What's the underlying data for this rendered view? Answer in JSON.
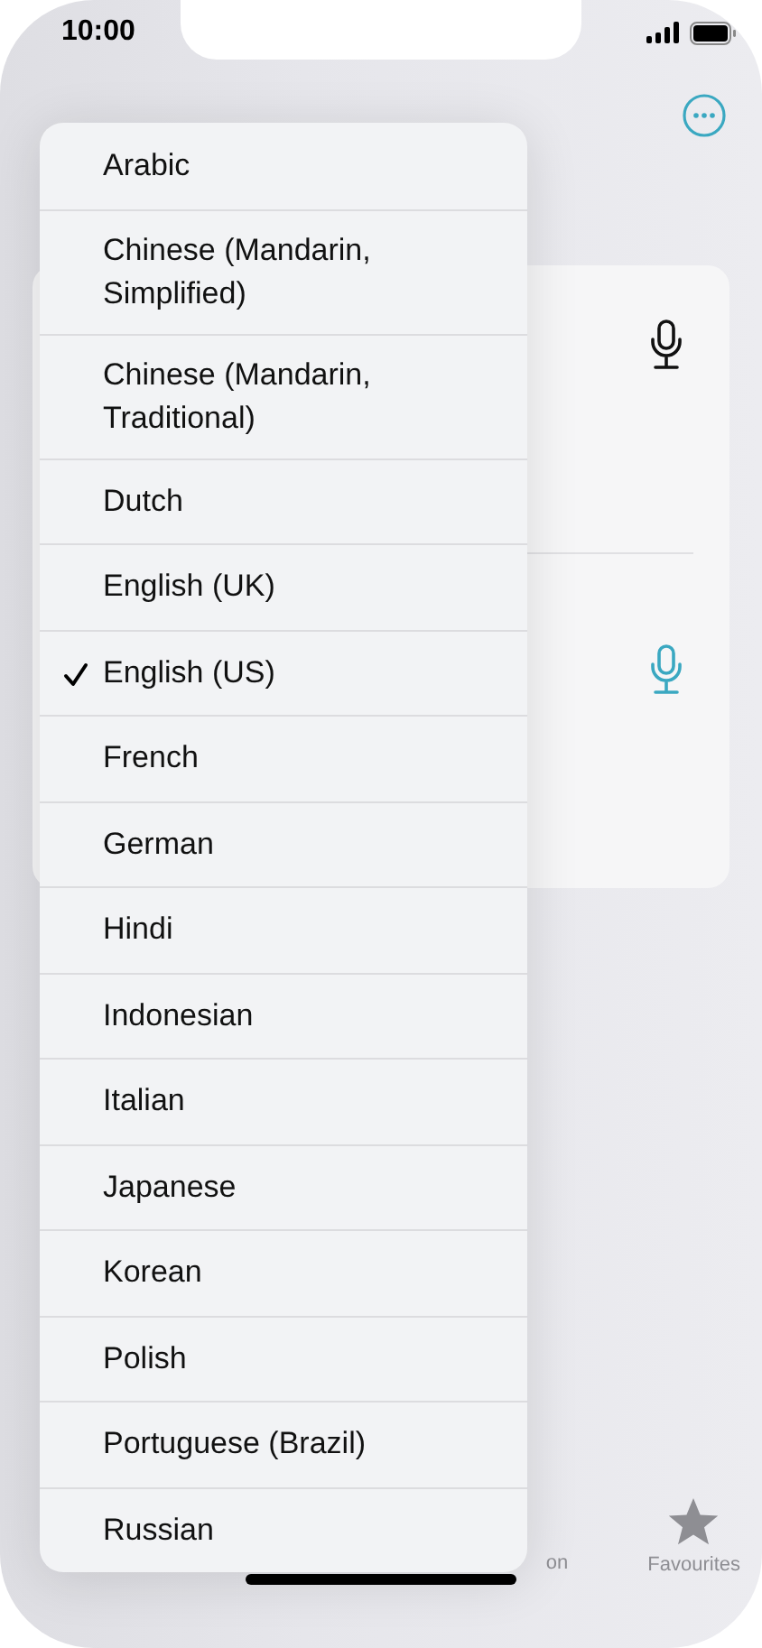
{
  "status_bar": {
    "time": "10:00"
  },
  "card": {
    "rows": [
      {
        "kind": "mic",
        "active": false
      },
      {
        "kind": "mic",
        "active": true
      }
    ]
  },
  "tab_bar": {
    "partial_label": "on",
    "items": [
      {
        "kind": "star",
        "label": "Favourites"
      }
    ]
  },
  "menu": {
    "items": [
      {
        "label": "Arabic",
        "selected": false
      },
      {
        "label": "Chinese (Mandarin, Simplified)",
        "selected": false
      },
      {
        "label": "Chinese (Mandarin, Traditional)",
        "selected": false
      },
      {
        "label": "Dutch",
        "selected": false
      },
      {
        "label": "English (UK)",
        "selected": false
      },
      {
        "label": "English (US)",
        "selected": true
      },
      {
        "label": "French",
        "selected": false
      },
      {
        "label": "German",
        "selected": false
      },
      {
        "label": "Hindi",
        "selected": false
      },
      {
        "label": "Indonesian",
        "selected": false
      },
      {
        "label": "Italian",
        "selected": false
      },
      {
        "label": "Japanese",
        "selected": false
      },
      {
        "label": "Korean",
        "selected": false
      },
      {
        "label": "Polish",
        "selected": false
      },
      {
        "label": "Portuguese (Brazil)",
        "selected": false
      },
      {
        "label": "Russian",
        "selected": false
      }
    ]
  }
}
